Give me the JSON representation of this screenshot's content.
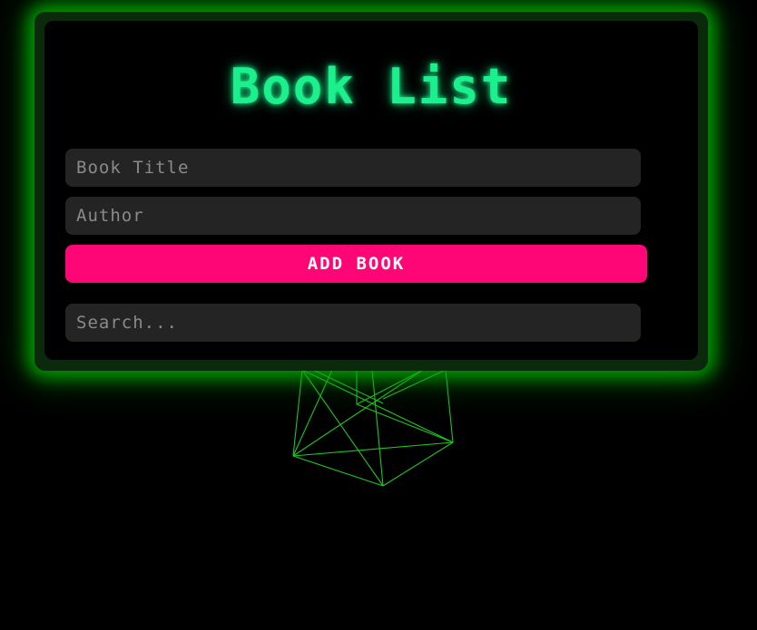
{
  "header": {
    "title": "Book List"
  },
  "form": {
    "title_placeholder": "Book Title",
    "author_placeholder": "Author",
    "add_label": "ADD BOOK"
  },
  "search": {
    "placeholder": "Search..."
  },
  "colors": {
    "background": "#000000",
    "title_glow": "#1cf08c",
    "frame_glow": "#00be00",
    "button": "#ff0677",
    "input_bg": "#242424",
    "wireframe": "#22dd22"
  }
}
